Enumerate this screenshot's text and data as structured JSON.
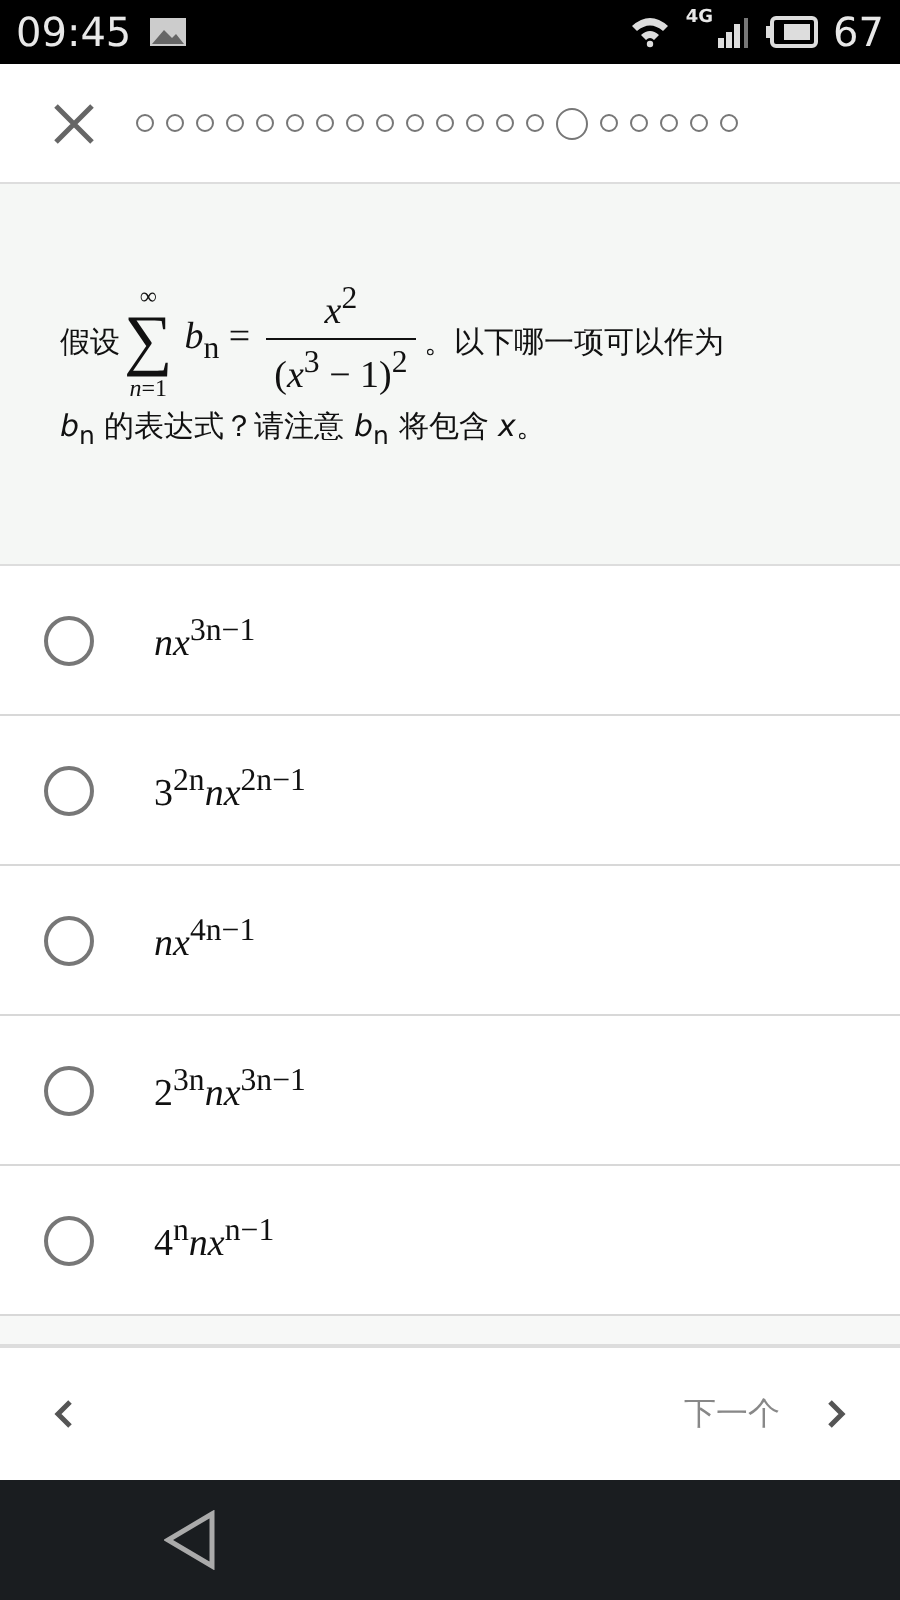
{
  "status_bar": {
    "time": "09:45",
    "network": "4G",
    "battery": "67"
  },
  "progress": [
    {
      "selected": false
    },
    {
      "selected": false
    },
    {
      "selected": false
    },
    {
      "selected": false
    },
    {
      "selected": false
    },
    {
      "selected": false
    },
    {
      "selected": false
    },
    {
      "selected": false
    },
    {
      "selected": false
    },
    {
      "selected": false
    },
    {
      "selected": false
    },
    {
      "selected": false
    },
    {
      "selected": false
    },
    {
      "selected": false
    },
    {
      "selected": true
    },
    {
      "selected": false
    },
    {
      "selected": false
    },
    {
      "selected": false
    },
    {
      "selected": false
    },
    {
      "selected": false
    }
  ],
  "question": [
    {
      "kind": "text",
      "text": "假设"
    },
    {
      "kind": "sum",
      "symbol": "∑",
      "upper": "∞",
      "lower": "*n*=1"
    },
    {
      "kind": "math",
      "text": "*b*$_{n}$ ="
    },
    {
      "kind": "fraction",
      "numerator": "*x*$^{2}$",
      "denominator": "(*x*$^{3}$ − 1)$^{2}$"
    },
    {
      "kind": "text",
      "text": "。以下哪一项可以作为"
    },
    {
      "kind": "text",
      "text": "*b*$_{n}$ 的表达式？请注意 *b*$_{n}$ 将包含 *x*。"
    }
  ],
  "options": [
    {
      "text": "*nx*$^{3n−1}$",
      "selected": false
    },
    {
      "text": "3$^{2n}$*nx*$^{2n−1}$",
      "selected": false
    },
    {
      "text": "*nx*$^{4n−1}$",
      "selected": false
    },
    {
      "text": "2$^{3n}$*nx*$^{3n−1}$",
      "selected": false
    },
    {
      "text": "4$^{n}$*nx*$^{n−1}$",
      "selected": false
    }
  ],
  "footer": {
    "next_label": "下一个"
  }
}
